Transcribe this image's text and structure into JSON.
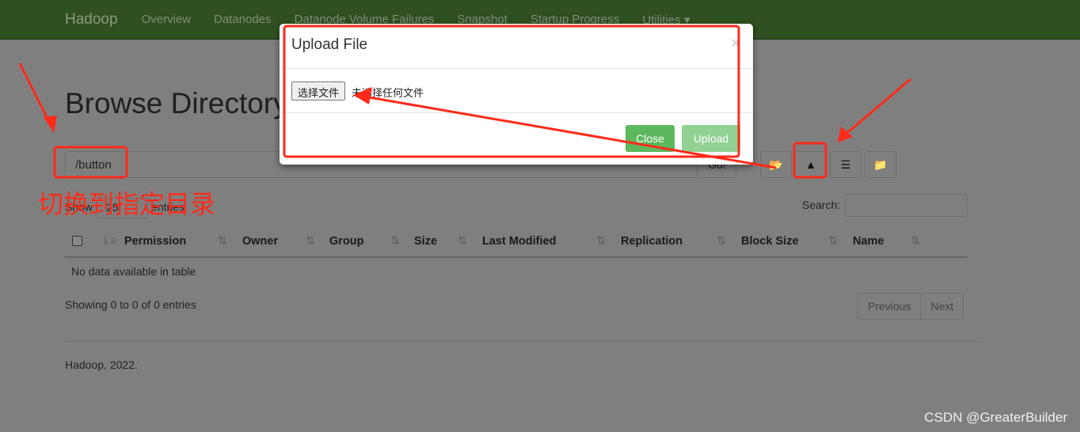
{
  "nav": {
    "brand": "Hadoop",
    "items": [
      "Overview",
      "Datanodes",
      "Datanode Volume Failures",
      "Snapshot",
      "Startup Progress",
      "Utilities ▾"
    ]
  },
  "page": {
    "title": "Browse Directory",
    "path": "/button",
    "go": "Go!"
  },
  "toolbar": {
    "icons": [
      "folder-open-icon",
      "cloud-upload-icon",
      "list-icon",
      "create-folder-icon"
    ]
  },
  "table": {
    "show": "Show",
    "entries_value": "25",
    "entries": "entries",
    "search_label": "Search:",
    "columns": [
      "Permission",
      "Owner",
      "Group",
      "Size",
      "Last Modified",
      "Replication",
      "Block Size",
      "Name"
    ],
    "empty": "No data available in table",
    "info": "Showing 0 to 0 of 0 entries",
    "prev": "Previous",
    "next": "Next"
  },
  "footer": "Hadoop, 2022.",
  "modal": {
    "title": "Upload File",
    "close_x": "×",
    "choose_file": "选择文件",
    "no_file": "未选择任何文件",
    "close": "Close",
    "upload": "Upload",
    "close_color": "#5cb85c",
    "upload_color": "#93d193"
  },
  "annotation": {
    "text": "切换到指定目录",
    "color": "#ff2a1a"
  },
  "watermark": "CSDN @GreaterBuilder"
}
